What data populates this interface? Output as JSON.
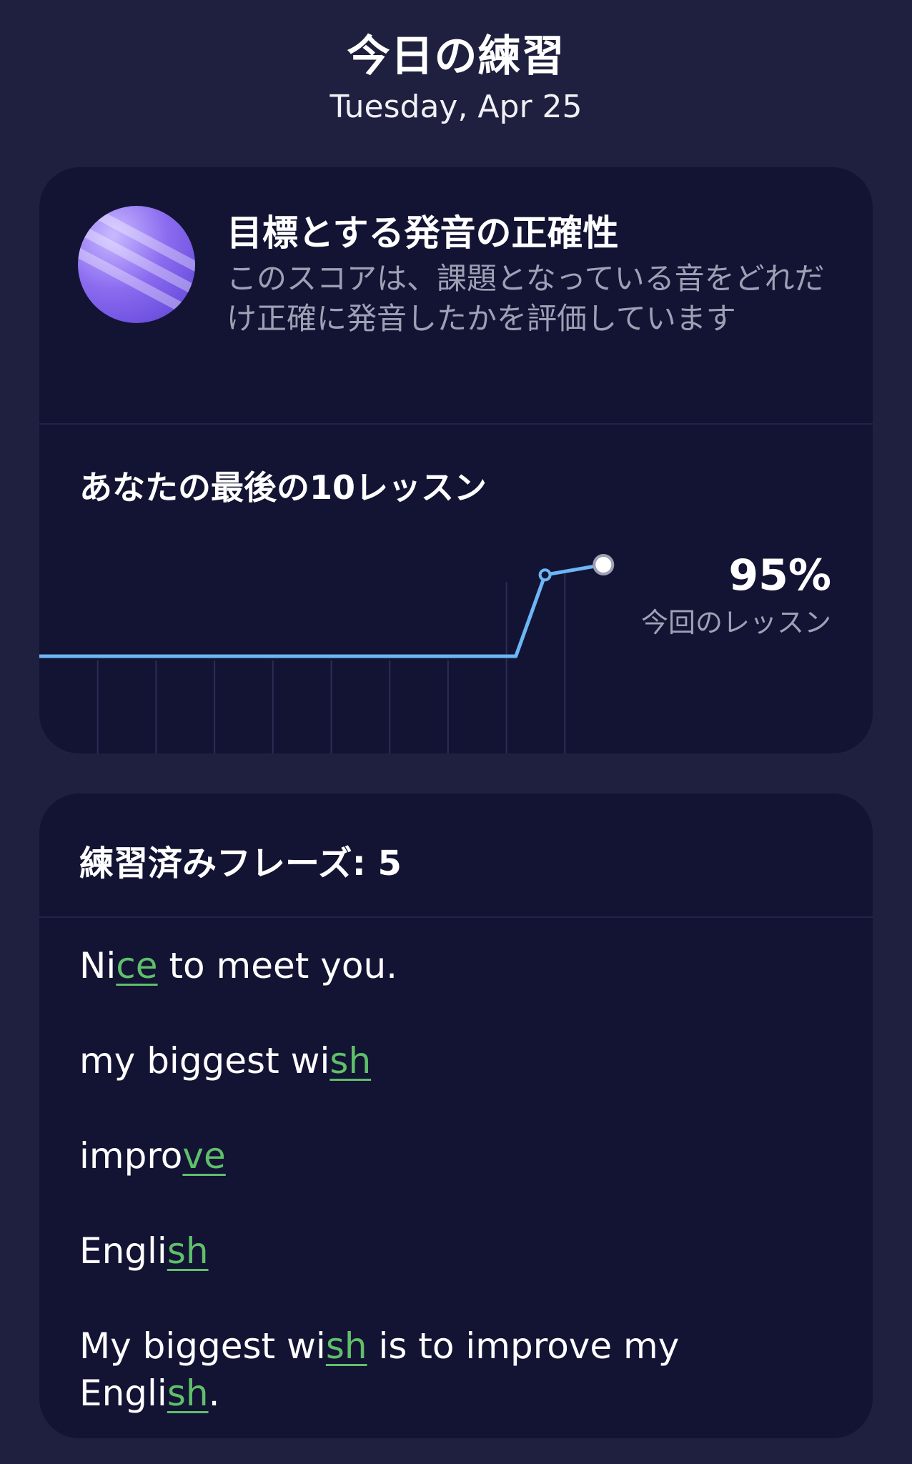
{
  "header": {
    "title": "今日の練習",
    "date": "Tuesday, Apr 25"
  },
  "goal_card": {
    "title": "目標とする発音の正確性",
    "description": "このスコアは、課題となっている音をどれだけ正確に発音したかを評価しています",
    "icon": "planet-icon",
    "chart_heading": "あなたの最後の10レッスン",
    "score": "95%",
    "score_label": "今回のレッスン"
  },
  "chart_data": {
    "type": "line",
    "series": [
      {
        "values": [
          null,
          null,
          null,
          null,
          null,
          null,
          null,
          null,
          90,
          95
        ]
      }
    ],
    "baseline": 50,
    "line_color": "#6cb6f5",
    "gridlines": "vertical"
  },
  "phrases_card": {
    "heading": "練習済みフレーズ: 5",
    "phrases": [
      {
        "before": "Ni",
        "highlight": "ce",
        "after": " to meet you."
      },
      {
        "before": "my biggest wi",
        "highlight": "sh",
        "after": ""
      },
      {
        "before": "impro",
        "highlight": "ve",
        "after": ""
      },
      {
        "before": "Engli",
        "highlight": "sh",
        "after": ""
      },
      {
        "before": "My biggest wi",
        "highlight": "sh",
        "after": " is to improve my ",
        "before2": "Engli",
        "highlight2": "sh",
        "after2": "."
      }
    ]
  },
  "colors": {
    "background": "#1f1f3f",
    "card": "#131334",
    "accent_line": "#6cb6f5",
    "highlight": "#5fbf6a"
  }
}
